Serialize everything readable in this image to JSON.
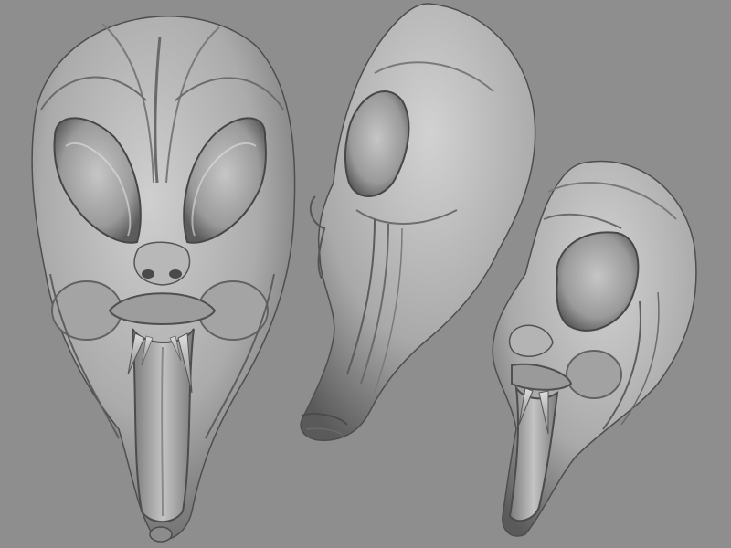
{
  "scene": {
    "background_color": "#8e8e8e",
    "material_color": "#b5b5b5",
    "views": [
      {
        "name": "front-view"
      },
      {
        "name": "side-view"
      },
      {
        "name": "three-quarter-view"
      }
    ]
  }
}
